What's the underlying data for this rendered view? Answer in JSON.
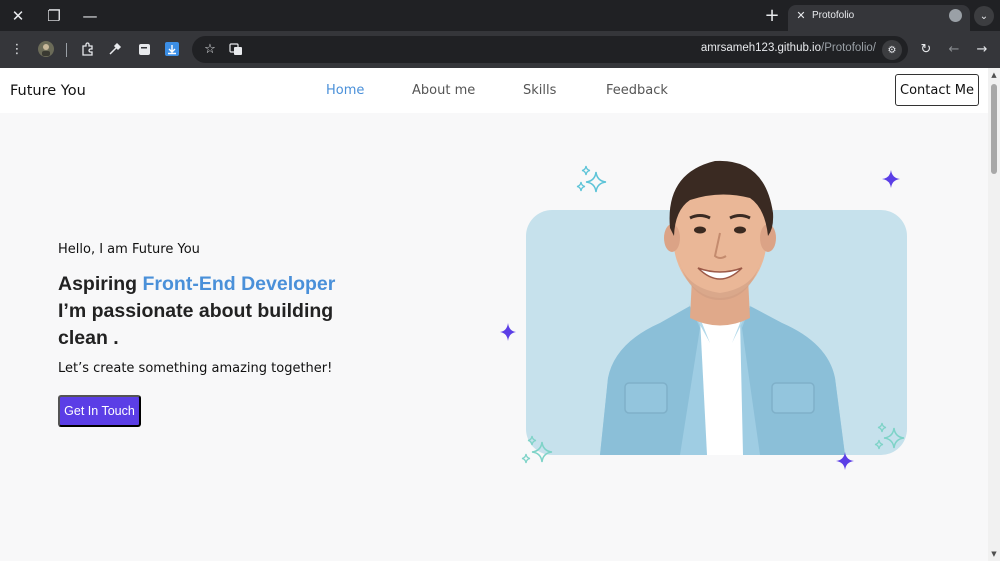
{
  "browser": {
    "tab_title": "Protofolio",
    "url_host": "amrsameh123.github.io",
    "url_path": "/Protofolio/",
    "icons": [
      "close-icon",
      "restore-icon",
      "minimize-icon",
      "plus-icon",
      "globe-icon",
      "chevron-down-icon",
      "kebab-icon",
      "profile-icon",
      "extensions-icon",
      "eyedropper-icon",
      "note-icon",
      "download-icon",
      "star-icon",
      "translate-icon",
      "tune-icon",
      "reload-icon",
      "back-icon",
      "forward-icon"
    ]
  },
  "nav": {
    "brand": "Future You",
    "links": [
      "Home",
      "About me",
      "Skills",
      "Feedback"
    ],
    "active": "Home",
    "contact_label": "Contact Me"
  },
  "hero": {
    "greeting": "Hello, I am Future You",
    "headline_prefix": "Aspiring ",
    "headline_accent": "Front-End Developer",
    "headline_rest": "I’m passionate about building clean .",
    "subline": "Let’s create something amazing together!",
    "cta_label": "Get In Touch"
  },
  "colors": {
    "accent": "#4a90d9",
    "cta": "#5b3ee6",
    "card": "#c6e1ec",
    "sparkle_purple": "#5b3ee6",
    "sparkle_teal": "#7fd3c8"
  }
}
